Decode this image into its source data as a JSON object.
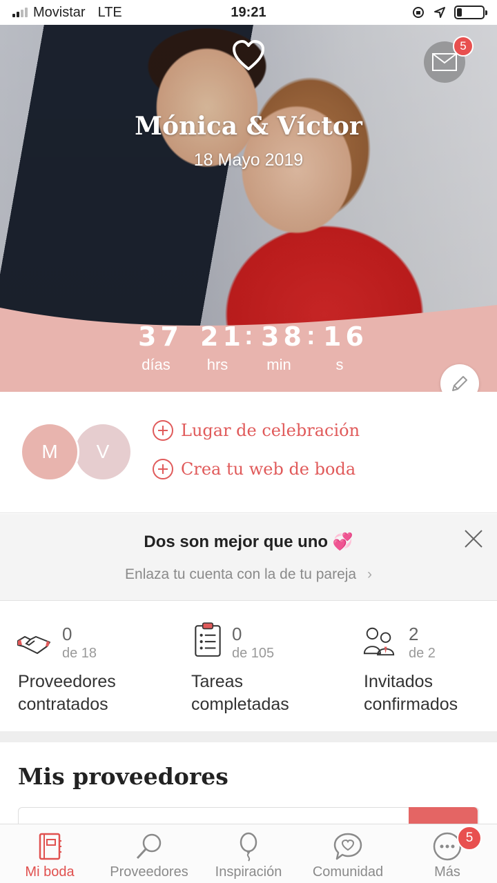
{
  "status_bar": {
    "carrier": "Movistar",
    "network": "LTE",
    "time": "19:21",
    "battery_level": 0.2
  },
  "hero": {
    "couple_names": "Mónica & Víctor",
    "date": "18 Mayo 2019",
    "mail_badge": "5",
    "countdown": {
      "days": "37",
      "hours": "21",
      "minutes": "38",
      "seconds": "16",
      "days_label": "días",
      "hours_label": "hrs",
      "minutes_label": "min",
      "seconds_label": "s"
    }
  },
  "couple": {
    "avatar_1": "M",
    "avatar_2": "V",
    "link_venue": "Lugar de celebración",
    "link_web": "Crea tu web de boda"
  },
  "banner": {
    "title": "Dos son mejor que uno 💞",
    "subtitle": "Enlaza tu cuenta con la de tu pareja"
  },
  "stats": [
    {
      "value": "0",
      "of": "de 18",
      "label_1": "Proveedores",
      "label_2": "contratados"
    },
    {
      "value": "0",
      "of": "de 105",
      "label_1": "Tareas",
      "label_2": "completadas"
    },
    {
      "value": "2",
      "of": "de 2",
      "label_1": "Invitados",
      "label_2": "confirmados"
    }
  ],
  "providers": {
    "title": "Mis proveedores"
  },
  "tab_bar": {
    "items": [
      {
        "label": "Mi boda",
        "icon": "notebook-icon"
      },
      {
        "label": "Proveedores",
        "icon": "search-icon"
      },
      {
        "label": "Inspiración",
        "icon": "balloon-icon"
      },
      {
        "label": "Comunidad",
        "icon": "chat-heart-icon"
      },
      {
        "label": "Más",
        "icon": "more-icon"
      }
    ],
    "more_badge": "5"
  },
  "colors": {
    "accent": "#e0504e",
    "hero_pink": "#e8b4ae",
    "link_red": "#e05a5a"
  }
}
